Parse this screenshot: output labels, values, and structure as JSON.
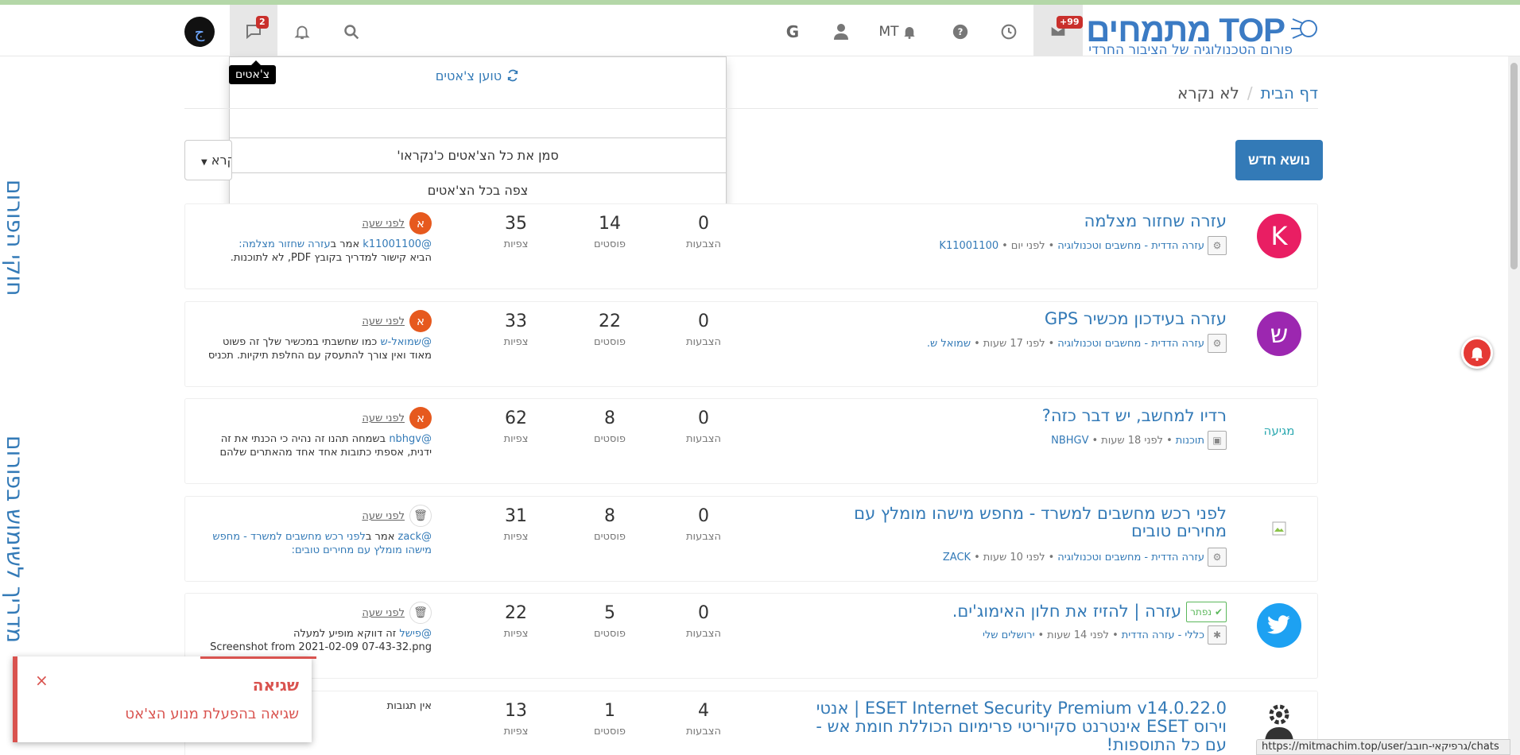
{
  "navbar": {
    "inbox_badge": "+99",
    "user_initials": "MT",
    "chats_badge": "2",
    "logo_main": "מתמחים TOP",
    "logo_sub": "פורום הטכנולוגיה של הציבור החרדי"
  },
  "chat_tooltip": "צ'אטים",
  "chat_dropdown": {
    "loading": "טוען צ'אטים",
    "mark_all_read": "סמן את כל הצ'אטים כ'נקראו'",
    "view_all": "צפה בכל הצ'אטים"
  },
  "breadcrumb": {
    "home": "דף הבית",
    "separator": "/",
    "current": "לא נקרא"
  },
  "new_topic_label": "נושא חדש",
  "filter_label": "לא נקרא",
  "side_labels": {
    "rules": "חוקי הפורום",
    "guide": "מדריך לשימוש בפורום"
  },
  "stat_labels": {
    "votes": "הצבעות",
    "posts": "פוסטים",
    "views": "צפיות"
  },
  "topics": [
    {
      "title": "עזרה שחזור מצלמה",
      "avatar": "K",
      "avatar_color": "#e91e63",
      "category": "עזרה הדדית - מחשבים וטכנולוגיה",
      "time": "לפני יום",
      "author": "K11001100",
      "votes": "0",
      "posts": "14",
      "views": "35",
      "lp_avatar": "א",
      "lp_time": "לפני שעה",
      "lp_user": "@k11001100",
      "lp_said": "אמר ב",
      "lp_link": "עזרה שחזור מצלמה:",
      "lp_text": "הביא קישור למדריך בקובץ PDF, לא לתוכנות."
    },
    {
      "title": "עזרה בעידכון מכשיר GPS",
      "avatar": "ש",
      "avatar_color": "#9c27b0",
      "category": "עזרה הדדית - מחשבים וטכנולוגיה",
      "time": "לפני 17 שעות",
      "author": "שמואל ש.",
      "votes": "0",
      "posts": "22",
      "views": "33",
      "lp_avatar": "א",
      "lp_time": "לפני שעה",
      "lp_user": "@שמואל-ש",
      "lp_text": "כמו שחשבתי במכשיר שלך זה פשוט מאוד ואין צורך להתעסק עם החלפת תיקיות. תכניס"
    },
    {
      "title": "רדיו למחשב, יש דבר כזה?",
      "avatar": "מגיעה",
      "category": "תוכנות",
      "time": "לפני 18 שעות",
      "author": "NBHGV",
      "votes": "0",
      "posts": "8",
      "views": "62",
      "lp_avatar": "א",
      "lp_time": "לפני שעה",
      "lp_user": "@nbhgv",
      "lp_text": "בשמחה תהנו זה נהיה כי הכנתי את זה ידנית, אספתי כתובות אחד אחד מהאתרים שלהם"
    },
    {
      "title": "לפני רכש מחשבים למשרד - מחפש מישהו מומלץ עם מחירים טובים",
      "category": "עזרה הדדית - מחשבים וטכנולוגיה",
      "time": "לפני 10 שעות",
      "author": "ZACK",
      "votes": "0",
      "posts": "8",
      "views": "31",
      "lp_time": "לפני שעה",
      "lp_user": "@zack",
      "lp_said": "אמר ב",
      "lp_link": "לפני רכש מחשבים למשרד - מחפש מישהו מומלץ עם מחירים טובים:"
    },
    {
      "solved": "נפתר",
      "title": "עזרה | להזיז את חלון האימוג'ים.",
      "category": "כללי - עזרה הדדית",
      "time": "לפני 14 שעות",
      "author": "ירושלים שלי",
      "votes": "0",
      "posts": "5",
      "views": "22",
      "lp_time": "לפני שעה",
      "lp_user": "@פישל",
      "lp_text": "זה דווקא מופיע למעלה",
      "lp_text2": "Screenshot from 2021-02-09 07-43-32.png"
    },
    {
      "title": "ESET Internet Security Premium v14.0.22.0 | אנטי וירוס ESET אינטרנט סקיוריטי פרימיום הכוללת חומת אש - עם כל התוספות!",
      "votes": "4",
      "posts": "1",
      "views": "13",
      "lp_none": "אין תגובות"
    }
  ],
  "error_toast": {
    "close": "×",
    "title": "שגיאה",
    "message": "שגיאה בהפעלת מנוע הצ'אט"
  },
  "status_url": "https://mitmachim.top/user/גרפיקאי-חובב/chats",
  "colors": {
    "primary": "#337ab7",
    "error": "#d9534f",
    "badge": "#c9302c"
  }
}
